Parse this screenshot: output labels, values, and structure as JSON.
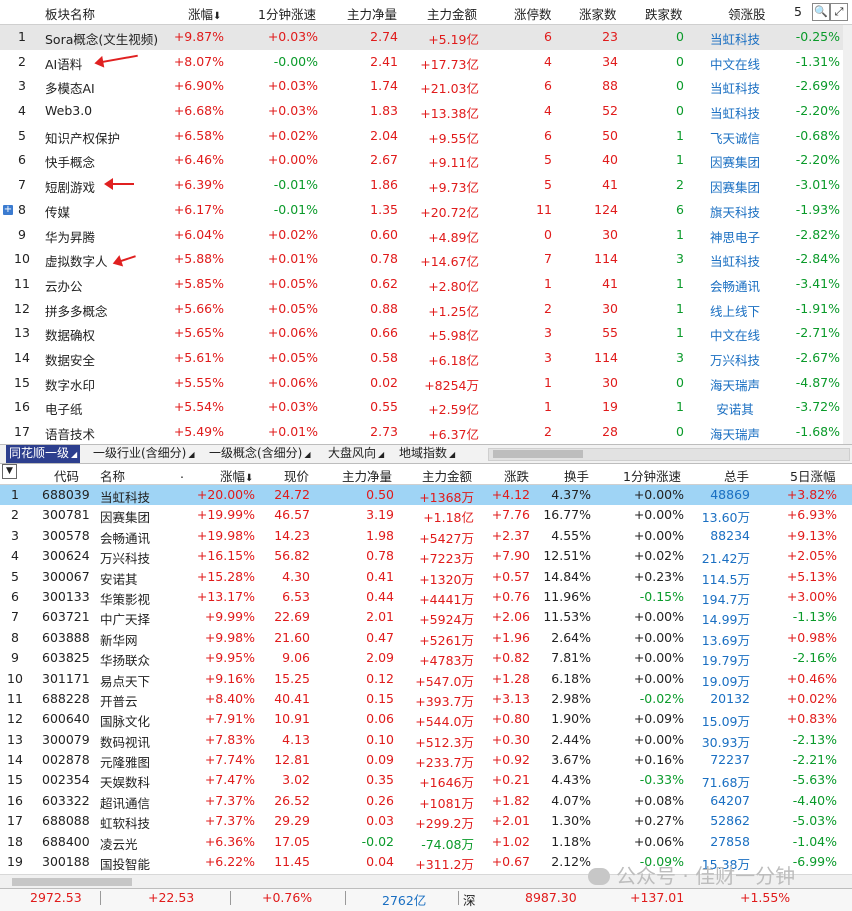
{
  "sector_table": {
    "headers": {
      "name": "板块名称",
      "change": "涨幅",
      "min_change": "1分钟涨速",
      "net_flow": "主力净量",
      "main_amount": "主力金额",
      "limit_up": "涨停数",
      "up_count": "涨家数",
      "down_count": "跌家数",
      "leader": "领涨股",
      "five_day": "5"
    },
    "rows": [
      {
        "num": "1",
        "name": "Sora概念(文生视频)",
        "change": "+9.87%",
        "min_change": "+0.03%",
        "net_flow": "2.74",
        "main_amount": "+5.19亿",
        "limit_up": "6",
        "up_count": "23",
        "down_count": "0",
        "leader": "当虹科技",
        "five_day": "-0.25%"
      },
      {
        "num": "2",
        "name": "AI语料",
        "change": "+8.07%",
        "min_change": "-0.00%",
        "net_flow": "2.41",
        "main_amount": "+17.73亿",
        "limit_up": "4",
        "up_count": "34",
        "down_count": "0",
        "leader": "中文在线",
        "five_day": "-1.31%"
      },
      {
        "num": "3",
        "name": "多模态AI",
        "change": "+6.90%",
        "min_change": "+0.03%",
        "net_flow": "1.74",
        "main_amount": "+21.03亿",
        "limit_up": "6",
        "up_count": "88",
        "down_count": "0",
        "leader": "当虹科技",
        "five_day": "-2.69%"
      },
      {
        "num": "4",
        "name": "Web3.0",
        "change": "+6.68%",
        "min_change": "+0.03%",
        "net_flow": "1.83",
        "main_amount": "+13.38亿",
        "limit_up": "4",
        "up_count": "52",
        "down_count": "0",
        "leader": "当虹科技",
        "five_day": "-2.20%"
      },
      {
        "num": "5",
        "name": "知识产权保护",
        "change": "+6.58%",
        "min_change": "+0.02%",
        "net_flow": "2.04",
        "main_amount": "+9.55亿",
        "limit_up": "6",
        "up_count": "50",
        "down_count": "1",
        "leader": "飞天诚信",
        "five_day": "-0.68%"
      },
      {
        "num": "6",
        "name": "快手概念",
        "change": "+6.46%",
        "min_change": "+0.00%",
        "net_flow": "2.67",
        "main_amount": "+9.11亿",
        "limit_up": "5",
        "up_count": "40",
        "down_count": "1",
        "leader": "因赛集团",
        "five_day": "-2.20%"
      },
      {
        "num": "7",
        "name": "短剧游戏",
        "change": "+6.39%",
        "min_change": "-0.01%",
        "net_flow": "1.86",
        "main_amount": "+9.73亿",
        "limit_up": "5",
        "up_count": "41",
        "down_count": "2",
        "leader": "因赛集团",
        "five_day": "-3.01%"
      },
      {
        "num": "8",
        "name": "传媒",
        "change": "+6.17%",
        "min_change": "-0.01%",
        "net_flow": "1.35",
        "main_amount": "+20.72亿",
        "limit_up": "11",
        "up_count": "124",
        "down_count": "6",
        "leader": "旗天科技",
        "five_day": "-1.93%"
      },
      {
        "num": "9",
        "name": "华为昇腾",
        "change": "+6.04%",
        "min_change": "+0.02%",
        "net_flow": "0.60",
        "main_amount": "+4.89亿",
        "limit_up": "0",
        "up_count": "30",
        "down_count": "1",
        "leader": "神思电子",
        "five_day": "-2.82%"
      },
      {
        "num": "10",
        "name": "虚拟数字人",
        "change": "+5.88%",
        "min_change": "+0.01%",
        "net_flow": "0.78",
        "main_amount": "+14.67亿",
        "limit_up": "7",
        "up_count": "114",
        "down_count": "3",
        "leader": "当虹科技",
        "five_day": "-2.84%"
      },
      {
        "num": "11",
        "name": "云办公",
        "change": "+5.85%",
        "min_change": "+0.05%",
        "net_flow": "0.62",
        "main_amount": "+2.80亿",
        "limit_up": "1",
        "up_count": "41",
        "down_count": "1",
        "leader": "会畅通讯",
        "five_day": "-3.41%"
      },
      {
        "num": "12",
        "name": "拼多多概念",
        "change": "+5.66%",
        "min_change": "+0.05%",
        "net_flow": "0.88",
        "main_amount": "+1.25亿",
        "limit_up": "2",
        "up_count": "30",
        "down_count": "1",
        "leader": "线上线下",
        "five_day": "-1.91%"
      },
      {
        "num": "13",
        "name": "数据确权",
        "change": "+5.65%",
        "min_change": "+0.06%",
        "net_flow": "0.66",
        "main_amount": "+5.98亿",
        "limit_up": "3",
        "up_count": "55",
        "down_count": "1",
        "leader": "中文在线",
        "five_day": "-2.71%"
      },
      {
        "num": "14",
        "name": "数据安全",
        "change": "+5.61%",
        "min_change": "+0.05%",
        "net_flow": "0.58",
        "main_amount": "+6.18亿",
        "limit_up": "3",
        "up_count": "114",
        "down_count": "3",
        "leader": "万兴科技",
        "five_day": "-2.67%"
      },
      {
        "num": "15",
        "name": "数字水印",
        "change": "+5.55%",
        "min_change": "+0.06%",
        "net_flow": "0.02",
        "main_amount": "+8254万",
        "limit_up": "1",
        "up_count": "30",
        "down_count": "0",
        "leader": "海天瑞声",
        "five_day": "-4.87%"
      },
      {
        "num": "16",
        "name": "电子纸",
        "change": "+5.54%",
        "min_change": "+0.03%",
        "net_flow": "0.55",
        "main_amount": "+2.59亿",
        "limit_up": "1",
        "up_count": "19",
        "down_count": "1",
        "leader": "安诺其",
        "five_day": "-3.72%"
      },
      {
        "num": "17",
        "name": "语音技术",
        "change": "+5.49%",
        "min_change": "+0.01%",
        "net_flow": "2.73",
        "main_amount": "+6.37亿",
        "limit_up": "2",
        "up_count": "28",
        "down_count": "0",
        "leader": "海天瑞声",
        "five_day": "-1.68%"
      }
    ]
  },
  "tabs": [
    "同花顺一级",
    "一级行业(含细分)",
    "一级概念(含细分)",
    "大盘风向",
    "地域指数"
  ],
  "stock_table": {
    "headers": {
      "code": "代码",
      "name": "名称",
      "dot": ".",
      "change": "涨幅",
      "price": "现价",
      "net_flow": "主力净量",
      "main_amount": "主力金额",
      "diff": "涨跌",
      "turnover": "换手",
      "min_change": "1分钟涨速",
      "cap": "总手",
      "five_day": "5日涨幅"
    },
    "rows": [
      {
        "num": "1",
        "code": "688039",
        "name": "当虹科技",
        "change": "+20.00%",
        "price": "24.72",
        "net_flow": "0.50",
        "main_amount": "+1368万",
        "diff": "+4.12",
        "turnover": "4.37%",
        "min_change": "+0.00%",
        "cap": "48869",
        "five_day": "+3.82%"
      },
      {
        "num": "2",
        "code": "300781",
        "name": "因赛集团",
        "change": "+19.99%",
        "price": "46.57",
        "net_flow": "3.19",
        "main_amount": "+1.18亿",
        "diff": "+7.76",
        "turnover": "16.77%",
        "min_change": "+0.00%",
        "cap": "13.60万",
        "five_day": "+6.93%"
      },
      {
        "num": "3",
        "code": "300578",
        "name": "会畅通讯",
        "change": "+19.98%",
        "price": "14.23",
        "net_flow": "1.98",
        "main_amount": "+5427万",
        "diff": "+2.37",
        "turnover": "4.55%",
        "min_change": "+0.00%",
        "cap": "88234",
        "five_day": "+9.13%"
      },
      {
        "num": "4",
        "code": "300624",
        "name": "万兴科技",
        "change": "+16.15%",
        "price": "56.82",
        "net_flow": "0.78",
        "main_amount": "+7223万",
        "diff": "+7.90",
        "turnover": "12.51%",
        "min_change": "+0.02%",
        "cap": "21.42万",
        "five_day": "+2.05%"
      },
      {
        "num": "5",
        "code": "300067",
        "name": "安诺其",
        "change": "+15.28%",
        "price": "4.30",
        "net_flow": "0.41",
        "main_amount": "+1320万",
        "diff": "+0.57",
        "turnover": "14.84%",
        "min_change": "+0.23%",
        "cap": "114.5万",
        "five_day": "+5.13%"
      },
      {
        "num": "6",
        "code": "300133",
        "name": "华策影视",
        "change": "+13.17%",
        "price": "6.53",
        "net_flow": "0.44",
        "main_amount": "+4441万",
        "diff": "+0.76",
        "turnover": "11.96%",
        "min_change": "-0.15%",
        "cap": "194.7万",
        "five_day": "+3.00%"
      },
      {
        "num": "7",
        "code": "603721",
        "name": "中广天择",
        "change": "+9.99%",
        "price": "22.69",
        "net_flow": "2.01",
        "main_amount": "+5924万",
        "diff": "+2.06",
        "turnover": "11.53%",
        "min_change": "+0.00%",
        "cap": "14.99万",
        "five_day": "-1.13%"
      },
      {
        "num": "8",
        "code": "603888",
        "name": "新华网",
        "change": "+9.98%",
        "price": "21.60",
        "net_flow": "0.47",
        "main_amount": "+5261万",
        "diff": "+1.96",
        "turnover": "2.64%",
        "min_change": "+0.00%",
        "cap": "13.69万",
        "five_day": "+0.98%"
      },
      {
        "num": "9",
        "code": "603825",
        "name": "华扬联众",
        "change": "+9.95%",
        "price": "9.06",
        "net_flow": "2.09",
        "main_amount": "+4783万",
        "diff": "+0.82",
        "turnover": "7.81%",
        "min_change": "+0.00%",
        "cap": "19.79万",
        "five_day": "-2.16%"
      },
      {
        "num": "10",
        "code": "301171",
        "name": "易点天下",
        "change": "+9.16%",
        "price": "15.25",
        "net_flow": "0.12",
        "main_amount": "+547.0万",
        "diff": "+1.28",
        "turnover": "6.18%",
        "min_change": "+0.00%",
        "cap": "19.09万",
        "five_day": "+0.46%"
      },
      {
        "num": "11",
        "code": "688228",
        "name": "开普云",
        "change": "+8.40%",
        "price": "40.41",
        "net_flow": "0.15",
        "main_amount": "+393.7万",
        "diff": "+3.13",
        "turnover": "2.98%",
        "min_change": "-0.02%",
        "cap": "20132",
        "five_day": "+0.02%"
      },
      {
        "num": "12",
        "code": "600640",
        "name": "国脉文化",
        "change": "+7.91%",
        "price": "10.91",
        "net_flow": "0.06",
        "main_amount": "+544.0万",
        "diff": "+0.80",
        "turnover": "1.90%",
        "min_change": "+0.09%",
        "cap": "15.09万",
        "five_day": "+0.83%"
      },
      {
        "num": "13",
        "code": "300079",
        "name": "数码视讯",
        "change": "+7.83%",
        "price": "4.13",
        "net_flow": "0.10",
        "main_amount": "+512.3万",
        "diff": "+0.30",
        "turnover": "2.44%",
        "min_change": "+0.00%",
        "cap": "30.93万",
        "five_day": "-2.13%"
      },
      {
        "num": "14",
        "code": "002878",
        "name": "元隆雅图",
        "change": "+7.74%",
        "price": "12.81",
        "net_flow": "0.09",
        "main_amount": "+233.7万",
        "diff": "+0.92",
        "turnover": "3.67%",
        "min_change": "+0.16%",
        "cap": "72237",
        "five_day": "-2.21%"
      },
      {
        "num": "15",
        "code": "002354",
        "name": "天娱数科",
        "change": "+7.47%",
        "price": "3.02",
        "net_flow": "0.35",
        "main_amount": "+1646万",
        "diff": "+0.21",
        "turnover": "4.43%",
        "min_change": "-0.33%",
        "cap": "71.68万",
        "five_day": "-5.63%"
      },
      {
        "num": "16",
        "code": "603322",
        "name": "超讯通信",
        "change": "+7.37%",
        "price": "26.52",
        "net_flow": "0.26",
        "main_amount": "+1081万",
        "diff": "+1.82",
        "turnover": "4.07%",
        "min_change": "+0.08%",
        "cap": "64207",
        "five_day": "-4.40%"
      },
      {
        "num": "17",
        "code": "688088",
        "name": "虹软科技",
        "change": "+7.37%",
        "price": "29.29",
        "net_flow": "0.03",
        "main_amount": "+299.2万",
        "diff": "+2.01",
        "turnover": "1.30%",
        "min_change": "+0.27%",
        "cap": "52862",
        "five_day": "-5.03%"
      },
      {
        "num": "18",
        "code": "688400",
        "name": "凌云光",
        "change": "+6.36%",
        "price": "17.05",
        "net_flow": "-0.02",
        "main_amount": "-74.08万",
        "diff": "+1.02",
        "turnover": "1.18%",
        "min_change": "+0.06%",
        "cap": "27858",
        "five_day": "-1.04%"
      },
      {
        "num": "19",
        "code": "300188",
        "name": "国投智能",
        "change": "+6.22%",
        "price": "11.45",
        "net_flow": "0.04",
        "main_amount": "+311.2万",
        "diff": "+0.67",
        "turnover": "2.12%",
        "min_change": "-0.09%",
        "cap": "15.38万",
        "five_day": "-6.99%"
      }
    ]
  },
  "status_bar": {
    "sh_value": "2972.53",
    "sh_change": "+22.53",
    "sh_pct": "+0.76%",
    "sh_amount": "2762亿",
    "sz_label": "深",
    "sz_value": "8987.30",
    "sz_change": "+137.01",
    "sz_pct": "+1.55%"
  },
  "watermark": "公众号 · 佳财一分钟",
  "colors": {
    "up": "#e01b1b",
    "down": "#0a9a2a",
    "leader": "#1a6fc2",
    "tab_active": "#2d3f8e",
    "selected_row": "#9fd4f5"
  }
}
